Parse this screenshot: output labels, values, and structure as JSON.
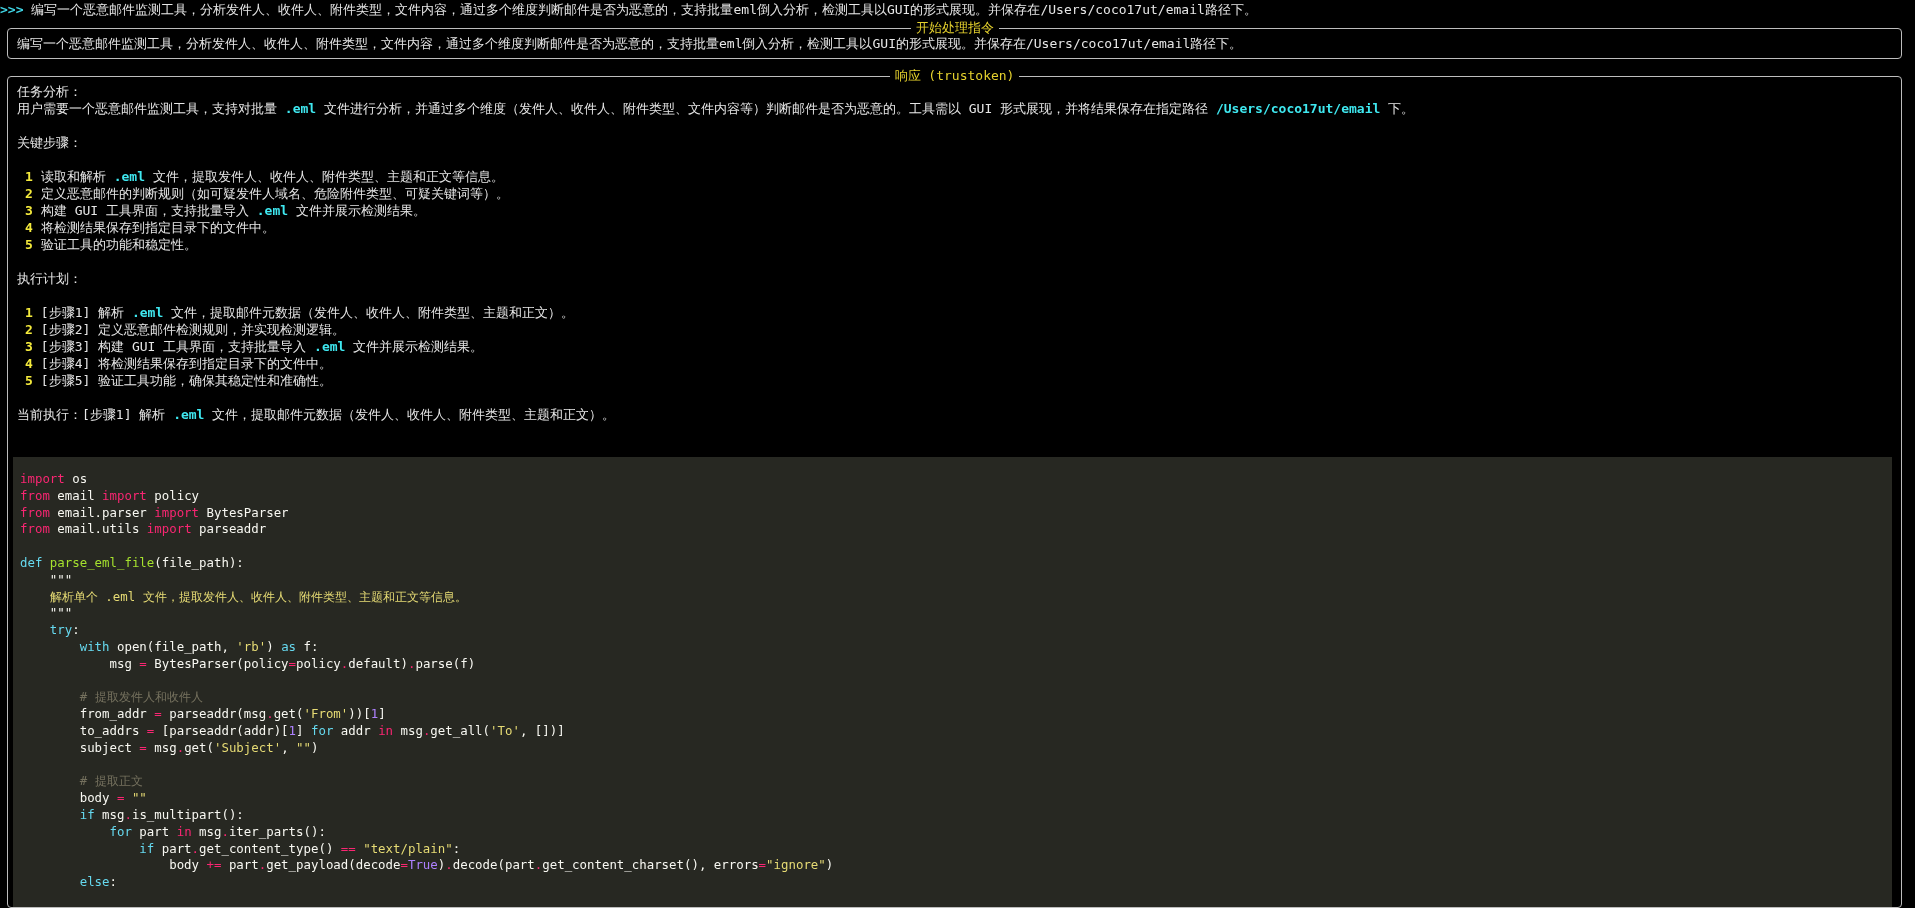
{
  "prompt": {
    "marker": ">>>",
    "text": "编写一个恶意邮件监测工具，分析发件人、收件人、附件类型，文件内容，通过多个维度判断邮件是否为恶意的，支持批量eml倒入分析，检测工具以GUI的形式展现。并保存在/Users/coco17ut/email路径下。"
  },
  "instruction_panel": {
    "title": "开始处理指令",
    "text": "编写一个恶意邮件监测工具，分析发件人、收件人、附件类型，文件内容，通过多个维度判断邮件是否为恶意的，支持批量eml倒入分析，检测工具以GUI的形式展现。并保存在/Users/coco17ut/email路径下。"
  },
  "response_panel": {
    "title": "响应 (trustoken)",
    "task_analysis": {
      "heading": "任务分析：",
      "segments": [
        {
          "text": "用户需要一个恶意邮件监测工具，支持对批量 ",
          "kind": "plain"
        },
        {
          "text": ".eml",
          "kind": "path"
        },
        {
          "text": " 文件进行分析，并通过多个维度（发件人、收件人、附件类型、文件内容等）判断邮件是否为恶意的。工具需以 GUI 形式展现，并将结果保存在指定路径 ",
          "kind": "plain"
        },
        {
          "text": "/Users/coco17ut/email",
          "kind": "path"
        },
        {
          "text": " 下。",
          "kind": "plain"
        }
      ]
    },
    "key_steps": {
      "heading": "关键步骤：",
      "items": [
        {
          "number": "1",
          "segments": [
            {
              "text": "读取和解析 ",
              "kind": "plain"
            },
            {
              "text": ".eml",
              "kind": "path"
            },
            {
              "text": " 文件，提取发件人、收件人、附件类型、主题和正文等信息。",
              "kind": "plain"
            }
          ]
        },
        {
          "number": "2",
          "segments": [
            {
              "text": "定义恶意邮件的判断规则（如可疑发件人域名、危险附件类型、可疑关键词等）。",
              "kind": "plain"
            }
          ]
        },
        {
          "number": "3",
          "segments": [
            {
              "text": "构建 GUI 工具界面，支持批量导入 ",
              "kind": "plain"
            },
            {
              "text": ".eml",
              "kind": "path"
            },
            {
              "text": " 文件并展示检测结果。",
              "kind": "plain"
            }
          ]
        },
        {
          "number": "4",
          "segments": [
            {
              "text": "将检测结果保存到指定目录下的文件中。",
              "kind": "plain"
            }
          ]
        },
        {
          "number": "5",
          "segments": [
            {
              "text": "验证工具的功能和稳定性。",
              "kind": "plain"
            }
          ]
        }
      ]
    },
    "plan": {
      "heading": "执行计划：",
      "items": [
        {
          "number": "1",
          "segments": [
            {
              "text": "[步骤1] 解析 ",
              "kind": "plain"
            },
            {
              "text": ".eml",
              "kind": "path"
            },
            {
              "text": " 文件，提取邮件元数据（发件人、收件人、附件类型、主题和正文）。",
              "kind": "plain"
            }
          ]
        },
        {
          "number": "2",
          "segments": [
            {
              "text": "[步骤2] 定义恶意邮件检测规则，并实现检测逻辑。",
              "kind": "plain"
            }
          ]
        },
        {
          "number": "3",
          "segments": [
            {
              "text": "[步骤3] 构建 GUI 工具界面，支持批量导入 ",
              "kind": "plain"
            },
            {
              "text": ".eml",
              "kind": "path"
            },
            {
              "text": " 文件并展示检测结果。",
              "kind": "plain"
            }
          ]
        },
        {
          "number": "4",
          "segments": [
            {
              "text": "[步骤4] 将检测结果保存到指定目录下的文件中。",
              "kind": "plain"
            }
          ]
        },
        {
          "number": "5",
          "segments": [
            {
              "text": "[步骤5] 验证工具功能，确保其稳定性和准确性。",
              "kind": "plain"
            }
          ]
        }
      ]
    },
    "current": {
      "segments": [
        {
          "text": "当前执行：[步骤1] 解析 ",
          "kind": "plain"
        },
        {
          "text": ".eml",
          "kind": "path"
        },
        {
          "text": " 文件，提取邮件元数据（发件人、收件人、附件类型、主题和正文）。",
          "kind": "plain"
        }
      ]
    },
    "code": {
      "blocks": [
        {
          "lines": [
            [
              {
                "text": "import",
                "kind": "keyword"
              },
              {
                "text": " os",
                "kind": "plain"
              }
            ],
            [
              {
                "text": "from",
                "kind": "keyword"
              },
              {
                "text": " email ",
                "kind": "plain"
              },
              {
                "text": "import",
                "kind": "keyword"
              },
              {
                "text": " policy",
                "kind": "plain"
              }
            ],
            [
              {
                "text": "from",
                "kind": "keyword"
              },
              {
                "text": " email.parser ",
                "kind": "plain"
              },
              {
                "text": "import",
                "kind": "keyword"
              },
              {
                "text": " BytesParser",
                "kind": "plain"
              }
            ],
            [
              {
                "text": "from",
                "kind": "keyword"
              },
              {
                "text": " email.utils ",
                "kind": "plain"
              },
              {
                "text": "import",
                "kind": "keyword"
              },
              {
                "text": " parseaddr",
                "kind": "plain"
              }
            ]
          ]
        },
        {
          "lines": [
            [
              {
                "text": "def",
                "kind": "storage"
              },
              {
                "text": " parse_eml_file",
                "kind": "function"
              },
              {
                "text": "(file_path):",
                "kind": "plain"
              }
            ],
            [
              {
                "text": "    \"\"\"",
                "kind": "plain"
              }
            ],
            [
              {
                "text": "    解析单个 .eml 文件，提取发件人、收件人、附件类型、主题和正文等信息。",
                "kind": "string"
              }
            ],
            [
              {
                "text": "    \"\"\"",
                "kind": "plain"
              }
            ],
            [
              {
                "text": "    try",
                "kind": "storage"
              },
              {
                "text": ":",
                "kind": "plain"
              }
            ],
            [
              {
                "text": "        with",
                "kind": "storage"
              },
              {
                "text": " open(file_path, ",
                "kind": "plain"
              },
              {
                "text": "'rb'",
                "kind": "string"
              },
              {
                "text": ") ",
                "kind": "plain"
              },
              {
                "text": "as",
                "kind": "storage"
              },
              {
                "text": " f:",
                "kind": "plain"
              }
            ],
            [
              {
                "text": "            msg ",
                "kind": "plain"
              },
              {
                "text": "=",
                "kind": "keyword"
              },
              {
                "text": " BytesParser(policy",
                "kind": "plain"
              },
              {
                "text": "=",
                "kind": "keyword"
              },
              {
                "text": "policy",
                "kind": "plain"
              },
              {
                "text": ".",
                "kind": "keyword"
              },
              {
                "text": "default)",
                "kind": "plain"
              },
              {
                "text": ".",
                "kind": "keyword"
              },
              {
                "text": "parse(f)",
                "kind": "plain"
              }
            ]
          ]
        },
        {
          "lines": [
            [
              {
                "text": "        # 提取发件人和收件人",
                "kind": "comment"
              }
            ],
            [
              {
                "text": "        from_addr ",
                "kind": "plain"
              },
              {
                "text": "=",
                "kind": "keyword"
              },
              {
                "text": " parseaddr(msg",
                "kind": "plain"
              },
              {
                "text": ".",
                "kind": "keyword"
              },
              {
                "text": "get(",
                "kind": "plain"
              },
              {
                "text": "'From'",
                "kind": "string"
              },
              {
                "text": "))[",
                "kind": "plain"
              },
              {
                "text": "1",
                "kind": "number"
              },
              {
                "text": "]",
                "kind": "plain"
              }
            ],
            [
              {
                "text": "        to_addrs ",
                "kind": "plain"
              },
              {
                "text": "=",
                "kind": "keyword"
              },
              {
                "text": " [parseaddr(addr)[",
                "kind": "plain"
              },
              {
                "text": "1",
                "kind": "number"
              },
              {
                "text": "] ",
                "kind": "plain"
              },
              {
                "text": "for",
                "kind": "storage"
              },
              {
                "text": " addr ",
                "kind": "plain"
              },
              {
                "text": "in",
                "kind": "keyword"
              },
              {
                "text": " msg",
                "kind": "plain"
              },
              {
                "text": ".",
                "kind": "keyword"
              },
              {
                "text": "get_all(",
                "kind": "plain"
              },
              {
                "text": "'To'",
                "kind": "string"
              },
              {
                "text": ", [])]",
                "kind": "plain"
              }
            ],
            [
              {
                "text": "        subject ",
                "kind": "plain"
              },
              {
                "text": "=",
                "kind": "keyword"
              },
              {
                "text": " msg",
                "kind": "plain"
              },
              {
                "text": ".",
                "kind": "keyword"
              },
              {
                "text": "get(",
                "kind": "plain"
              },
              {
                "text": "'Subject'",
                "kind": "string"
              },
              {
                "text": ", ",
                "kind": "plain"
              },
              {
                "text": "\"\"",
                "kind": "string"
              },
              {
                "text": ")",
                "kind": "plain"
              }
            ]
          ]
        },
        {
          "lines": [
            [
              {
                "text": "        # 提取正文",
                "kind": "comment"
              }
            ],
            [
              {
                "text": "        body ",
                "kind": "plain"
              },
              {
                "text": "=",
                "kind": "keyword"
              },
              {
                "text": " \"\"",
                "kind": "string"
              }
            ],
            [
              {
                "text": "        if",
                "kind": "storage"
              },
              {
                "text": " msg",
                "kind": "plain"
              },
              {
                "text": ".",
                "kind": "keyword"
              },
              {
                "text": "is_multipart():",
                "kind": "plain"
              }
            ],
            [
              {
                "text": "            for",
                "kind": "storage"
              },
              {
                "text": " part ",
                "kind": "plain"
              },
              {
                "text": "in",
                "kind": "keyword"
              },
              {
                "text": " msg",
                "kind": "plain"
              },
              {
                "text": ".",
                "kind": "keyword"
              },
              {
                "text": "iter_parts():",
                "kind": "plain"
              }
            ],
            [
              {
                "text": "                if",
                "kind": "storage"
              },
              {
                "text": " part",
                "kind": "plain"
              },
              {
                "text": ".",
                "kind": "keyword"
              },
              {
                "text": "get_content_type() ",
                "kind": "plain"
              },
              {
                "text": "==",
                "kind": "keyword"
              },
              {
                "text": " \"text/plain\"",
                "kind": "string"
              },
              {
                "text": ":",
                "kind": "plain"
              }
            ],
            [
              {
                "text": "                    body ",
                "kind": "plain"
              },
              {
                "text": "+=",
                "kind": "keyword"
              },
              {
                "text": " part",
                "kind": "plain"
              },
              {
                "text": ".",
                "kind": "keyword"
              },
              {
                "text": "get_payload(decode",
                "kind": "plain"
              },
              {
                "text": "=",
                "kind": "keyword"
              },
              {
                "text": "True",
                "kind": "number"
              },
              {
                "text": ")",
                "kind": "plain"
              },
              {
                "text": ".",
                "kind": "keyword"
              },
              {
                "text": "decode(part",
                "kind": "plain"
              },
              {
                "text": ".",
                "kind": "keyword"
              },
              {
                "text": "get_content_charset(), errors",
                "kind": "plain"
              },
              {
                "text": "=",
                "kind": "keyword"
              },
              {
                "text": "\"ignore\"",
                "kind": "string"
              },
              {
                "text": ")",
                "kind": "plain"
              }
            ],
            [
              {
                "text": "        else",
                "kind": "storage"
              },
              {
                "text": ":",
                "kind": "plain"
              }
            ]
          ]
        }
      ]
    }
  }
}
